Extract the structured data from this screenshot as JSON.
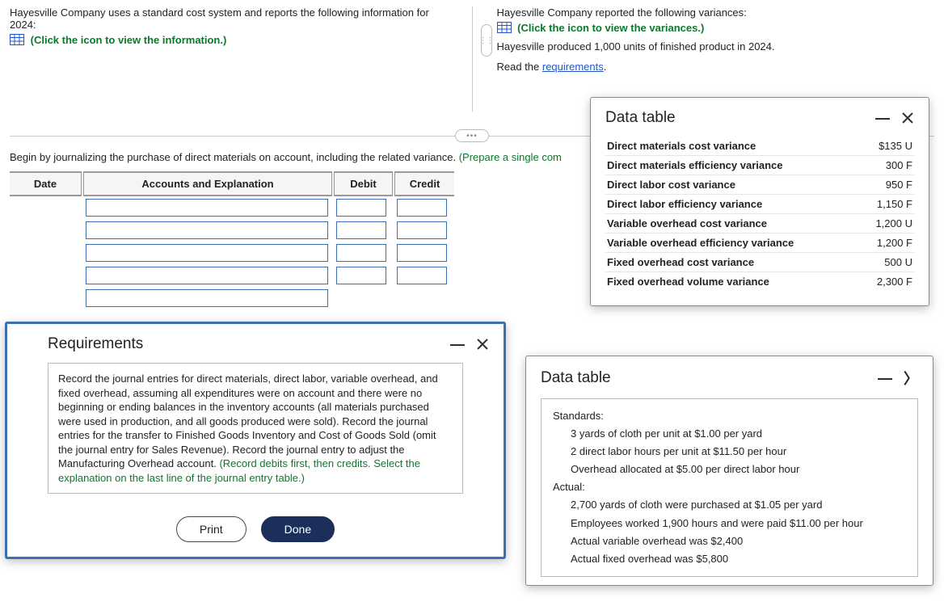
{
  "top_left": {
    "intro": "Hayesville Company uses a standard cost system and reports the following information for 2024:",
    "click_info": "(Click the icon to view the information.)"
  },
  "top_right": {
    "intro": "Hayesville Company reported the following variances:",
    "click_var": "(Click the icon to view the variances.)",
    "produced": "Hayesville produced 1,000 units of finished product in 2024.",
    "read": "Read the ",
    "req_link": "requirements"
  },
  "instruction": {
    "lead": "Begin by journalizing the purchase of direct materials on account, including the related variance. ",
    "paren": "(Prepare a single com"
  },
  "journal_headers": {
    "date": "Date",
    "acct": "Accounts and Explanation",
    "debit": "Debit",
    "credit": "Credit"
  },
  "modal_variances": {
    "title": "Data table",
    "rows": [
      {
        "label": "Direct materials cost variance",
        "value": "$135 U"
      },
      {
        "label": "Direct materials efficiency variance",
        "value": "300 F"
      },
      {
        "label": "Direct labor cost variance",
        "value": "950 F"
      },
      {
        "label": "Direct labor efficiency variance",
        "value": "1,150 F"
      },
      {
        "label": "Variable overhead cost variance",
        "value": "1,200 U"
      },
      {
        "label": "Variable overhead efficiency variance",
        "value": "1,200 F"
      },
      {
        "label": "Fixed overhead cost variance",
        "value": "500 U"
      },
      {
        "label": "Fixed overhead volume variance",
        "value": "2,300 F"
      }
    ]
  },
  "modal_requirements": {
    "title": "Requirements",
    "body": "Record the journal entries for direct materials, direct labor, variable overhead, and fixed overhead, assuming all expenditures were on account and there were no beginning or ending balances in the inventory accounts (all materials purchased were used in production, and all goods produced were sold). Record the journal entries for the transfer to Finished Goods Inventory and Cost of Goods Sold (omit the journal entry for Sales Revenue). Record the journal entry to adjust the Manufacturing Overhead account. ",
    "body_green": "(Record debits first, then credits. Select the explanation on the last line of the journal entry table.)",
    "print": "Print",
    "done": "Done"
  },
  "modal_standards": {
    "title": "Data table",
    "std_label": "Standards:",
    "std_lines": [
      "3 yards of cloth per unit at $1.00 per yard",
      "2 direct labor hours per unit at $11.50 per hour",
      "Overhead allocated at $5.00 per direct labor hour"
    ],
    "act_label": "Actual:",
    "act_lines": [
      "2,700 yards of cloth were purchased at $1.05 per yard",
      "Employees worked 1,900 hours and were paid $11.00 per hour",
      "Actual variable overhead was $2,400",
      "Actual fixed overhead was $5,800"
    ]
  }
}
